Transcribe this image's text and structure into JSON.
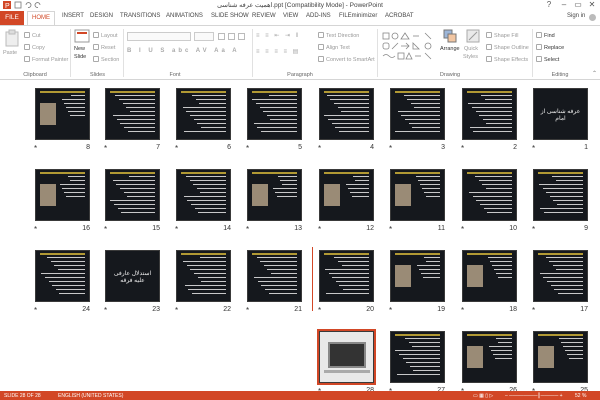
{
  "window": {
    "title": "اهمیت عرفه شناسی.ppt [Compatibility Mode] - PowerPoint",
    "minimize": "–",
    "restore": "▭",
    "close": "✕",
    "help": "?",
    "user": "Sign in"
  },
  "tabs": [
    "FILE",
    "HOME",
    "INSERT",
    "DESIGN",
    "TRANSITIONS",
    "ANIMATIONS",
    "SLIDE SHOW",
    "REVIEW",
    "VIEW",
    "ADD-INS",
    "FILEminimizer",
    "ACROBAT"
  ],
  "ribbon": {
    "clipboard": {
      "paste": "Paste",
      "cut": "Cut",
      "copy": "Copy",
      "format_painter": "Format Painter",
      "label": "Clipboard"
    },
    "slides": {
      "new_slide": "New",
      "new_slide_2": "Slide",
      "layout": "Layout",
      "reset": "Reset",
      "section": "Section",
      "label": "Slides"
    },
    "font": {
      "label": "Font"
    },
    "paragraph": {
      "text_direction": "Text Direction",
      "align_text": "Align Text",
      "convert_smartart": "Convert to SmartArt",
      "label": "Paragraph"
    },
    "drawing": {
      "arrange": "Arrange",
      "quick_styles": "Quick",
      "quick_styles_2": "Styles",
      "shape_fill": "Shape Fill",
      "shape_outline": "Shape Outline",
      "shape_effects": "Shape Effects",
      "label": "Drawing"
    },
    "editing": {
      "find": "Find",
      "replace": "Replace",
      "select": "Select",
      "label": "Editing"
    }
  },
  "slides": [
    {
      "n": "1",
      "kind": "title",
      "text": "عرفه شناسی از امام"
    },
    {
      "n": "2",
      "kind": "text"
    },
    {
      "n": "3",
      "kind": "text"
    },
    {
      "n": "4",
      "kind": "text"
    },
    {
      "n": "5",
      "kind": "text"
    },
    {
      "n": "6",
      "kind": "text"
    },
    {
      "n": "7",
      "kind": "text"
    },
    {
      "n": "8",
      "kind": "photo"
    },
    {
      "n": "9",
      "kind": "text"
    },
    {
      "n": "10",
      "kind": "text"
    },
    {
      "n": "11",
      "kind": "photo"
    },
    {
      "n": "12",
      "kind": "photo"
    },
    {
      "n": "13",
      "kind": "photo"
    },
    {
      "n": "14",
      "kind": "text"
    },
    {
      "n": "15",
      "kind": "text"
    },
    {
      "n": "16",
      "kind": "photo"
    },
    {
      "n": "17",
      "kind": "text"
    },
    {
      "n": "18",
      "kind": "photo"
    },
    {
      "n": "19",
      "kind": "photo"
    },
    {
      "n": "20",
      "kind": "text"
    },
    {
      "n": "21",
      "kind": "text"
    },
    {
      "n": "22",
      "kind": "text"
    },
    {
      "n": "23",
      "kind": "title",
      "text": "استدلال عارفی علیه فرقه"
    },
    {
      "n": "24",
      "kind": "text"
    },
    {
      "n": "25",
      "kind": "photo"
    },
    {
      "n": "26",
      "kind": "photo"
    },
    {
      "n": "27",
      "kind": "text"
    },
    {
      "n": "28",
      "kind": "laptop"
    }
  ],
  "status": {
    "slide_of": "SLIDE 28 OF 28",
    "language": "ENGLISH (UNITED STATES)",
    "zoom": "52 %"
  },
  "colors": {
    "accent": "#d24726",
    "slide_bg": "#15181d"
  }
}
